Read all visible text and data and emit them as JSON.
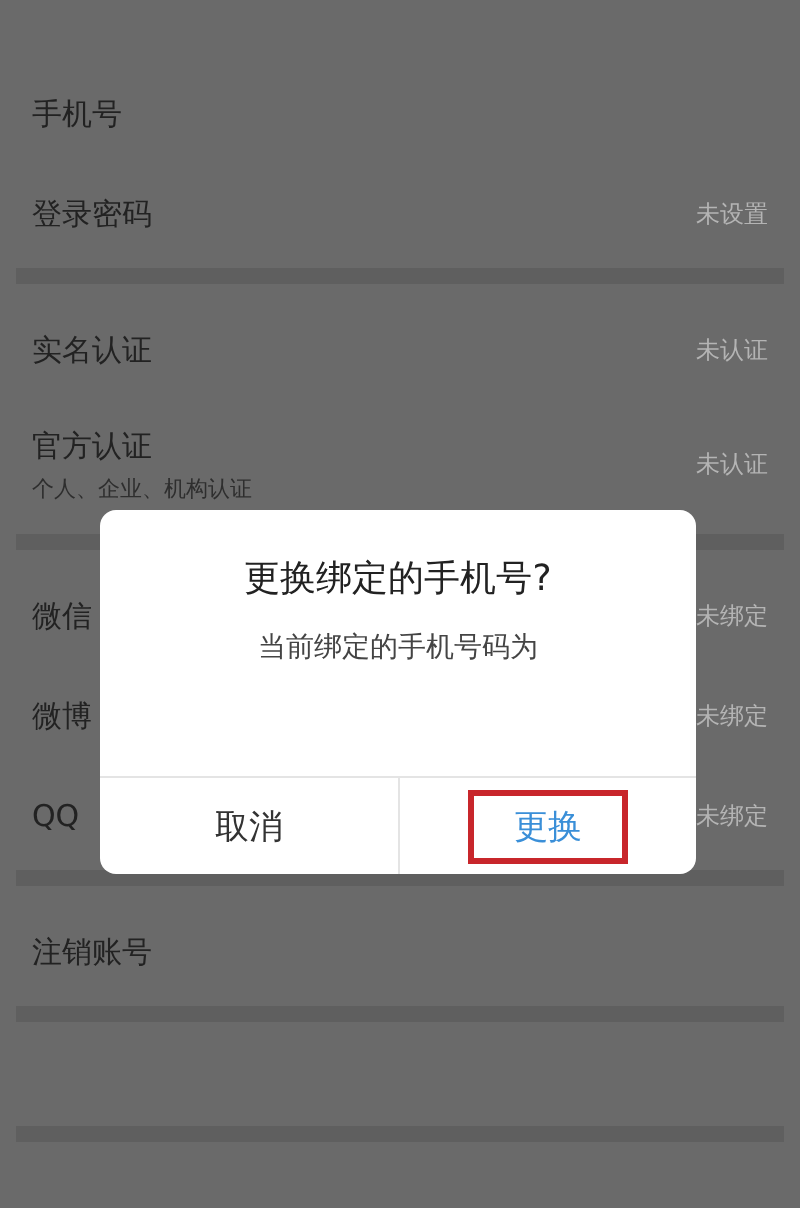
{
  "settings": [
    {
      "kind": "row",
      "label": "手机号"
    },
    {
      "kind": "row",
      "label": "登录密码",
      "value": "未设置"
    },
    {
      "kind": "gap"
    },
    {
      "kind": "row",
      "label": "实名认证",
      "value": "未认证"
    },
    {
      "kind": "row",
      "label": "官方认证",
      "sublabel": "个人、企业、机构认证",
      "value": "未认证"
    },
    {
      "kind": "gap"
    },
    {
      "kind": "row",
      "label": "微信",
      "value": "未绑定"
    },
    {
      "kind": "row",
      "label": "微博",
      "value": "未绑定"
    },
    {
      "kind": "row",
      "label": "QQ",
      "value": "未绑定"
    },
    {
      "kind": "gap"
    },
    {
      "kind": "row",
      "label": "注销账号"
    },
    {
      "kind": "gap"
    },
    {
      "kind": "blank"
    },
    {
      "kind": "gap"
    }
  ],
  "dialog": {
    "title": "更换绑定的手机号?",
    "message": "当前绑定的手机号码为",
    "buttons": [
      {
        "label": "取消",
        "primary": false,
        "highlighted": false
      },
      {
        "label": "更换",
        "primary": true,
        "highlighted": true
      }
    ]
  }
}
